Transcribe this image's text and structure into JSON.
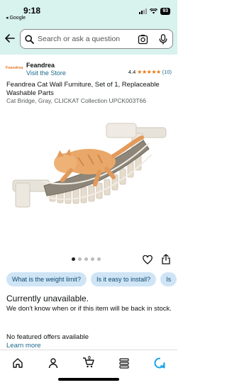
{
  "status_bar": {
    "time": "9:18",
    "back_app": "◂ Google",
    "battery": "93"
  },
  "search": {
    "placeholder": "Search or ask a question"
  },
  "brand": {
    "logo_text": "Feandrea",
    "name": "Feandrea",
    "visit_store": "Visit the Store",
    "rating": "4.4",
    "stars": "★★★★★",
    "rating_count": "(10)"
  },
  "product": {
    "title": "Feandrea Cat Wall Furniture, Set of 1, Replaceable Washable Parts",
    "subtitle": "Cat Bridge, Gray, CLICKAT Collection UPCK003T66"
  },
  "questions": [
    "What is the weight limit?",
    "Is it easy to install?",
    "Is"
  ],
  "availability": {
    "status": "Currently unavailable.",
    "message": "We don't know when or if this item will be back in stock.",
    "offers": "No featured offers available",
    "learn_more": "Learn more"
  },
  "cart_count": "0",
  "colors": {
    "header_bg": "#d8f2ee",
    "link": "#1d6a8a",
    "chip_bg": "#cfe5f6",
    "star": "#e8770e",
    "alexa": "#1aa3e8"
  }
}
